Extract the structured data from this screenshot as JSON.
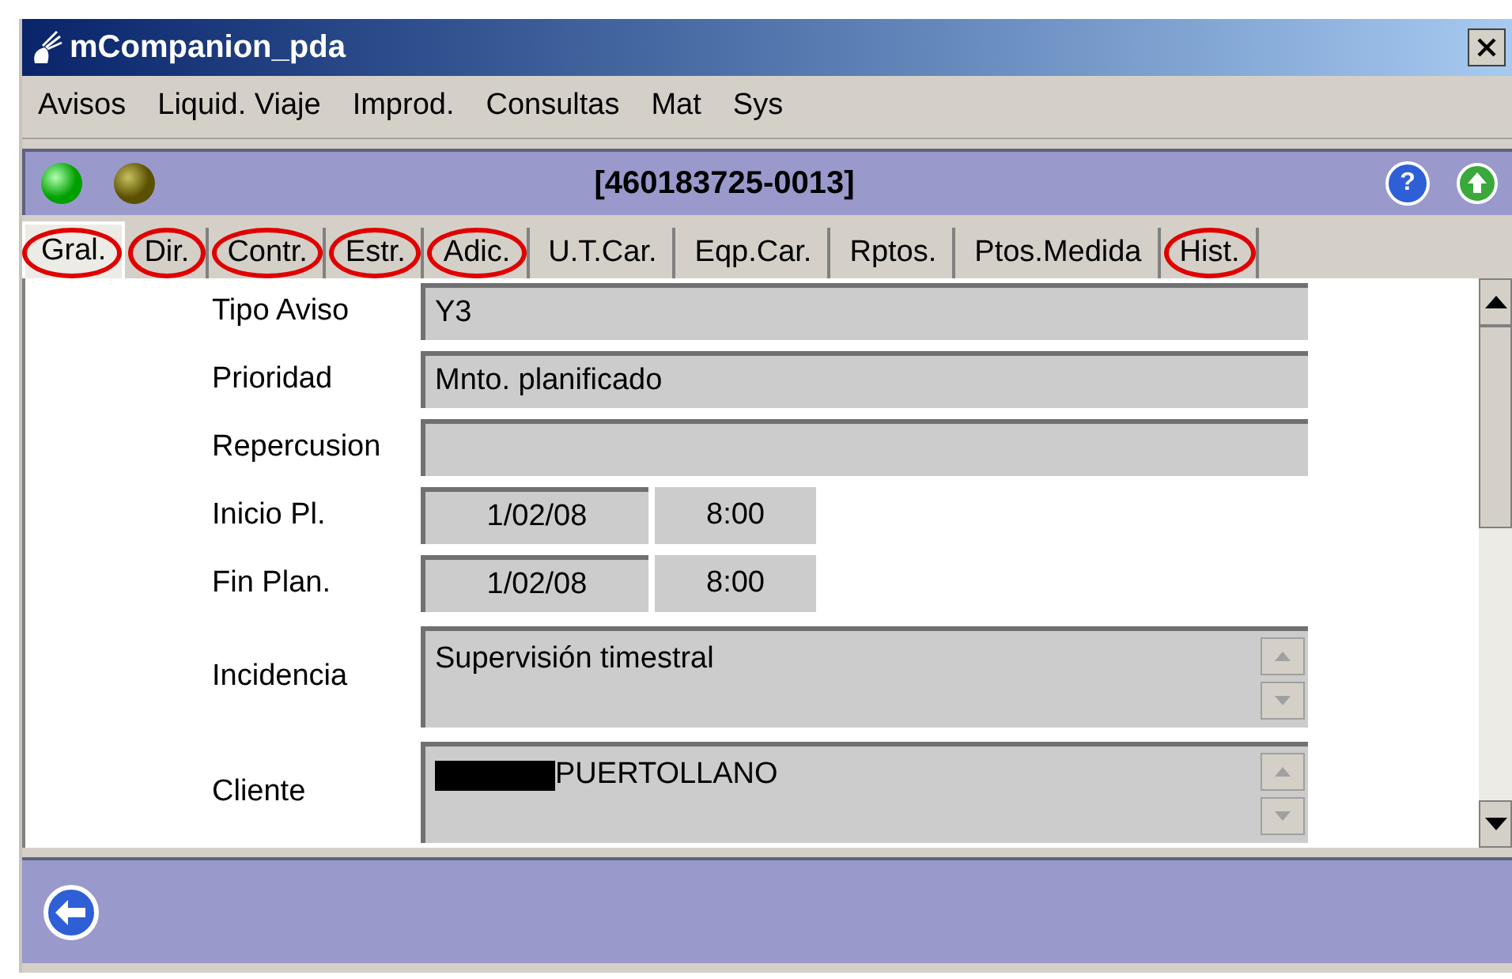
{
  "window": {
    "title": "mCompanion_pda"
  },
  "menu": [
    "Avisos",
    "Liquid. Viaje",
    "Improd.",
    "Consultas",
    "Mat",
    "Sys"
  ],
  "header": {
    "title": "[460183725-0013]",
    "help": "?"
  },
  "tabs": [
    {
      "label": "Gral.",
      "selected": true,
      "circled": true
    },
    {
      "label": "Dir.",
      "selected": false,
      "circled": true
    },
    {
      "label": "Contr.",
      "selected": false,
      "circled": true
    },
    {
      "label": "Estr.",
      "selected": false,
      "circled": true
    },
    {
      "label": "Adic.",
      "selected": false,
      "circled": true
    },
    {
      "label": "U.T.Car.",
      "selected": false,
      "circled": false
    },
    {
      "label": "Eqp.Car.",
      "selected": false,
      "circled": false
    },
    {
      "label": "Rptos.",
      "selected": false,
      "circled": false
    },
    {
      "label": "Ptos.Medida",
      "selected": false,
      "circled": false
    },
    {
      "label": "Hist.",
      "selected": false,
      "circled": true
    }
  ],
  "fields": [
    {
      "kind": "text",
      "label": "Tipo Aviso",
      "value": "Y3"
    },
    {
      "kind": "text",
      "label": "Prioridad",
      "value": "Mnto. planificado"
    },
    {
      "kind": "text",
      "label": "Repercusion"
    },
    {
      "kind": "datetime",
      "label": "Inicio Pl.",
      "date": "1/02/08",
      "time": "8:00"
    },
    {
      "kind": "datetime",
      "label": "Fin Plan.",
      "date": "1/02/08",
      "time": "8:00"
    },
    {
      "kind": "memo",
      "label": "Incidencia",
      "value": "Supervisión timestral"
    },
    {
      "kind": "memo",
      "label": "Cliente",
      "value": "PUERTOLLANO",
      "redacted": true
    }
  ]
}
